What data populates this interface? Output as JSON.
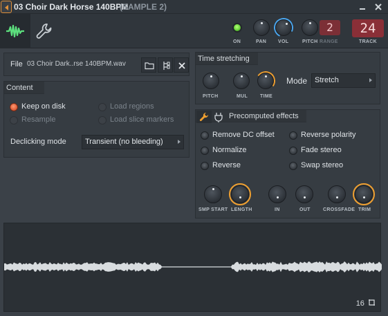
{
  "window": {
    "title": "03 Choir Dark Horse 140BPM",
    "subtitle": "(SAMPLE 2)"
  },
  "header": {
    "knobs": {
      "on": "ON",
      "pan": "PAN",
      "vol": "VOL",
      "pitch": "PITCH",
      "range": "RANGE",
      "track": "TRACK"
    },
    "range_value": "2",
    "track_value": "24"
  },
  "file": {
    "label": "File",
    "name": "03 Choir Dark..rse 140BPM.wav"
  },
  "content": {
    "title": "Content",
    "options": [
      {
        "label": "Keep on disk",
        "checked": true,
        "enabled": true
      },
      {
        "label": "Load regions",
        "checked": false,
        "enabled": false
      },
      {
        "label": "Resample",
        "checked": false,
        "enabled": false
      },
      {
        "label": "Load slice markers",
        "checked": false,
        "enabled": false
      }
    ],
    "declicking_label": "Declicking mode",
    "declicking_value": "Transient (no bleeding)"
  },
  "time_stretching": {
    "title": "Time stretching",
    "knobs": [
      "PITCH",
      "MUL",
      "TIME"
    ],
    "mode_label": "Mode",
    "mode_value": "Stretch"
  },
  "precomputed": {
    "title": "Precomputed effects",
    "effects": [
      {
        "label": "Remove DC offset",
        "checked": false
      },
      {
        "label": "Reverse polarity",
        "checked": false
      },
      {
        "label": "Normalize",
        "checked": false
      },
      {
        "label": "Fade stereo",
        "checked": false
      },
      {
        "label": "Reverse",
        "checked": false
      },
      {
        "label": "Swap stereo",
        "checked": false
      }
    ],
    "knobs": [
      "SMP START",
      "LENGTH",
      "IN",
      "OUT",
      "CROSSFADE",
      "TRIM"
    ]
  },
  "waveform": {
    "footer_value": "16"
  },
  "colors": {
    "accent_orange": "#f0a030",
    "accent_blue": "#4aa7f0",
    "led_green": "#67d43a",
    "track_red": "#8a2f37",
    "wave": "#d8dcdf"
  }
}
